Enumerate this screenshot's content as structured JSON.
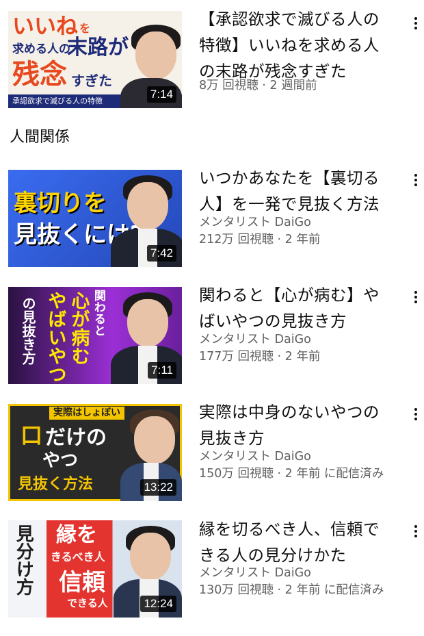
{
  "section": {
    "title": "人間関係"
  },
  "videos": [
    {
      "title": "【承認欲求で滅びる人の特徴】いいねを求める人の末路が残念すぎた",
      "channel": "",
      "meta": "8万 回視聴 · 2 週間前",
      "duration": "7:14",
      "thumb_lines": [
        "いいね",
        "を",
        "求める人の",
        "末路が",
        "残念",
        "すぎた",
        "承認欲求で滅びる人の特徴"
      ],
      "colors": {
        "bg": "#f5f1e8",
        "accent": "#e8481e",
        "text": "#1e2b78"
      }
    },
    {
      "title": "いつかあなたを【裏切る人】を一発で見抜く方法",
      "channel": "メンタリスト DaiGo",
      "meta": "212万 回視聴 · 2 年前",
      "duration": "7:42",
      "thumb_lines": [
        "裏切りを",
        "見抜くには?"
      ],
      "colors": {
        "bg": "#2f5fd9",
        "accent": "#ffd400",
        "text": "#ffffff"
      }
    },
    {
      "title": "関わると【心が病む】やばいやつの見抜き方",
      "channel": "メンタリスト DaiGo",
      "meta": "177万 回視聴 · 2 年前",
      "duration": "7:11",
      "thumb_lines": [
        "関わると",
        "心が病む",
        "やばいやつ",
        "の見抜き方"
      ],
      "colors": {
        "bg": "#8a2fc9",
        "accent": "#ffe800",
        "text": "#ffffff"
      }
    },
    {
      "title": "実際は中身のないやつの見抜き方",
      "channel": "メンタリスト DaiGo",
      "meta": "150万 回視聴 · 2 年前 に配信済み",
      "duration": "13:22",
      "thumb_lines": [
        "実際はしょぼい",
        "口",
        "だけの",
        "やつ",
        "見抜く方法"
      ],
      "colors": {
        "bg": "#f3c400",
        "accent": "#1e1e1e",
        "text": "#ffffff"
      }
    },
    {
      "title": "縁を切るべき人、信頼できる人の見分けかた",
      "channel": "メンタリスト DaiGo",
      "meta": "130万 回視聴 · 2 年前 に配信済み",
      "duration": "12:24",
      "thumb_lines": [
        "見分け方",
        "縁を",
        "きるべき人",
        "信頼",
        "できる人"
      ],
      "colors": {
        "bg": "#e7eef5",
        "accent": "#e3342f",
        "text": "#ffffff"
      }
    }
  ]
}
